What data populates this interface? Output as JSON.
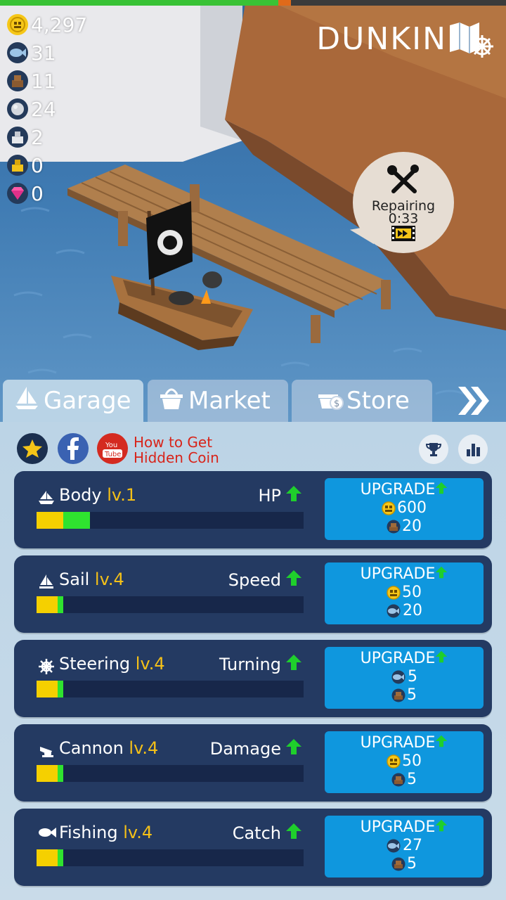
{
  "player": {
    "name": "DUNKIN"
  },
  "resources": [
    {
      "icon": "coin-icon",
      "value": "4,297"
    },
    {
      "icon": "fish-icon",
      "value": "31"
    },
    {
      "icon": "wood-icon",
      "value": "11"
    },
    {
      "icon": "stone-icon",
      "value": "24"
    },
    {
      "icon": "iron-icon",
      "value": "2"
    },
    {
      "icon": "gold-icon",
      "value": "0"
    },
    {
      "icon": "gem-icon",
      "value": "0"
    }
  ],
  "repair": {
    "label": "Repairing",
    "timer": "0:33"
  },
  "tabs": [
    {
      "label": "Garage",
      "active": true
    },
    {
      "label": "Market"
    },
    {
      "label": "Store"
    }
  ],
  "howto": {
    "line1": "How to Get",
    "line2": "Hidden Coin"
  },
  "upgrades": [
    {
      "name": "Body",
      "level": "lv.1",
      "stat": "HP",
      "yellow": 0.1,
      "green": 0.1,
      "button": "UPGRADE",
      "cost": [
        {
          "icon": "coin-icon",
          "value": "600"
        },
        {
          "icon": "wood-icon",
          "value": "20"
        }
      ]
    },
    {
      "name": "Sail",
      "level": "lv.4",
      "stat": "Speed",
      "yellow": 0.08,
      "green": 0.02,
      "button": "UPGRADE",
      "cost": [
        {
          "icon": "coin-icon",
          "value": "50"
        },
        {
          "icon": "fish-icon",
          "value": "20"
        }
      ]
    },
    {
      "name": "Steering",
      "level": "lv.4",
      "stat": "Turning",
      "yellow": 0.08,
      "green": 0.02,
      "button": "UPGRADE",
      "cost": [
        {
          "icon": "fish-icon",
          "value": "5"
        },
        {
          "icon": "wood-icon",
          "value": "5"
        }
      ]
    },
    {
      "name": "Cannon",
      "level": "lv.4",
      "stat": "Damage",
      "yellow": 0.08,
      "green": 0.02,
      "button": "UPGRADE",
      "cost": [
        {
          "icon": "coin-icon",
          "value": "50"
        },
        {
          "icon": "wood-icon",
          "value": "5"
        }
      ]
    },
    {
      "name": "Fishing",
      "level": "lv.4",
      "stat": "Catch",
      "yellow": 0.08,
      "green": 0.02,
      "button": "UPGRADE",
      "cost": [
        {
          "icon": "fish-icon",
          "value": "27"
        },
        {
          "icon": "wood-icon",
          "value": "5"
        }
      ]
    }
  ],
  "colors": {
    "card": "#243a62",
    "button": "#0f97de",
    "level": "#f4c018",
    "arrow": "#1fcf2c"
  }
}
